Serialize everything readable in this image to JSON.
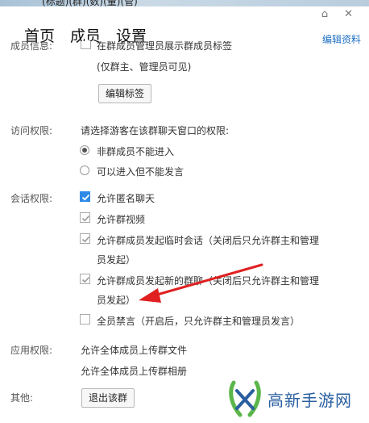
{
  "window": {
    "top_text": "(标题)(群)(数)(量)(管)"
  },
  "tabs": [
    "首页",
    "成员",
    "设置"
  ],
  "edit_profile": "编辑资料",
  "group_info": {
    "label": "成员信息:",
    "text": "在群成员管理员展示群成员标签",
    "note": "(仅群主、管理员可见)",
    "edit_tags_button": "编辑标签"
  },
  "access": {
    "label": "访问权限:",
    "prompt": "请选择游客在该群聊天窗口的权限:",
    "options": [
      {
        "label": "非群成员不能进入",
        "selected": true
      },
      {
        "label": "可以进入但不能发言",
        "selected": false
      }
    ]
  },
  "session": {
    "label": "会话权限:",
    "options": [
      {
        "label": "允许匿名聊天",
        "checked": true,
        "style": "blue"
      },
      {
        "label": "允许群视频",
        "checked": true,
        "style": "gray"
      },
      {
        "label": "允许群成员发起临时会话（关闭后只允许群主和管理",
        "label2": "员发起）",
        "checked": true,
        "style": "gray"
      },
      {
        "label": "允许群成员发起新的群聊（关闭后只允许群主和管理",
        "label2": "员发起）",
        "checked": true,
        "style": "gray"
      },
      {
        "label": "全员禁言（开启后，只允许群主和管理员发言）",
        "checked": false,
        "style": "empty"
      }
    ],
    "arrow_color": "#e02020"
  },
  "app": {
    "label": "应用权限:",
    "items": [
      "允许全体成员上传群文件",
      "允许全体成员上传群相册"
    ]
  },
  "other": {
    "label": "其他:",
    "quit_button": "退出该群"
  },
  "watermark": {
    "text": "高新手游网"
  },
  "colors": {
    "link": "#1f6fc5",
    "check_blue": "#2e8ae6",
    "check_gray": "#c4c4c4"
  }
}
